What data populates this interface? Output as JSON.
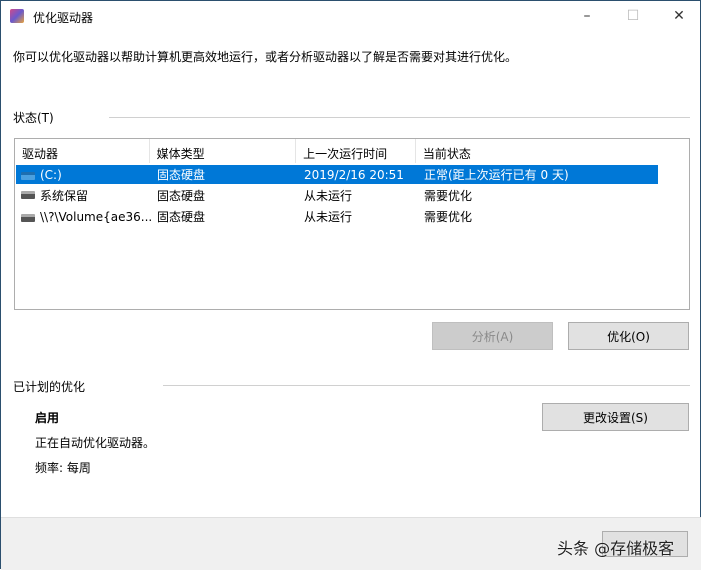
{
  "window": {
    "title": "优化驱动器",
    "minimize": "–",
    "maximize": "☐",
    "close": "✕"
  },
  "description": "你可以优化驱动器以帮助计算机更高效地运行，或者分析驱动器以了解是否需要对其进行优化。",
  "status": {
    "label": "状态(T)",
    "columns": [
      "驱动器",
      "媒体类型",
      "上一次运行时间",
      "当前状态"
    ],
    "rows": [
      {
        "drive": "(C:)",
        "media": "固态硬盘",
        "last_run": "2019/2/16 20:51",
        "state": "正常(距上次运行已有 0 天)",
        "selected": true
      },
      {
        "drive": "系统保留",
        "media": "固态硬盘",
        "last_run": "从未运行",
        "state": "需要优化"
      },
      {
        "drive": "\\\\?\\Volume{ae36...",
        "media": "固态硬盘",
        "last_run": "从未运行",
        "state": "需要优化"
      }
    ]
  },
  "buttons": {
    "analyze": "分析(A)",
    "optimize": "优化(O)",
    "change_settings": "更改设置(S)"
  },
  "scheduled": {
    "label": "已计划的优化",
    "state": "启用",
    "detail": "正在自动优化驱动器。",
    "frequency": "频率: 每周"
  },
  "watermark": "头条 @存储极客"
}
